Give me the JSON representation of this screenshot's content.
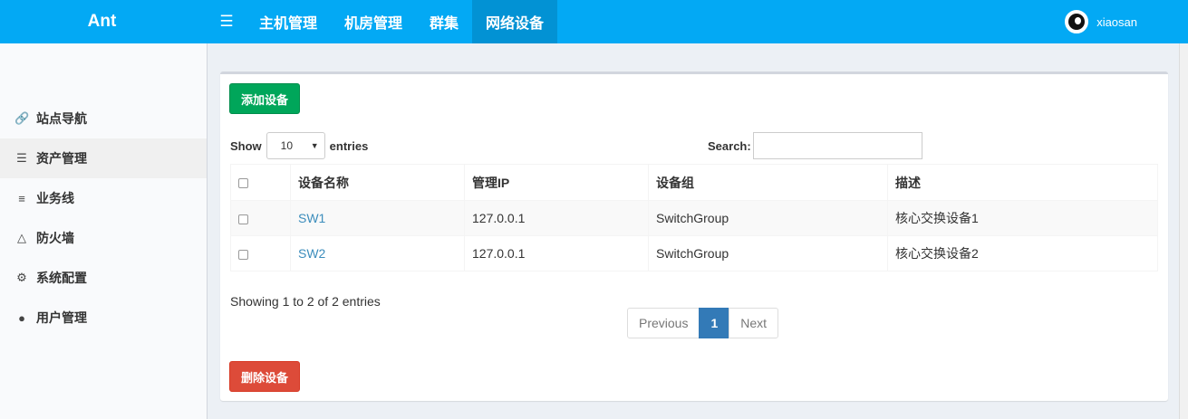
{
  "brand": "Ant",
  "topnav": {
    "toggle_icon": "hamburger-icon",
    "items": [
      {
        "label": "主机管理"
      },
      {
        "label": "机房管理"
      },
      {
        "label": "群集"
      },
      {
        "label": "网络设备"
      }
    ],
    "active_index": 3,
    "user": "xiaosan"
  },
  "sidebar": {
    "items": [
      {
        "label": "站点导航",
        "icon": "link-icon"
      },
      {
        "label": "资产管理",
        "icon": "database-icon"
      },
      {
        "label": "业务线",
        "icon": "server-icon"
      },
      {
        "label": "防火墙",
        "icon": "firewall-icon"
      },
      {
        "label": "系统配置",
        "icon": "gear-icon"
      },
      {
        "label": "用户管理",
        "icon": "users-icon"
      }
    ],
    "active_index": 1
  },
  "main": {
    "add_button": "添加设备",
    "delete_button": "删除设备",
    "length": {
      "show": "Show",
      "value": "10",
      "entries": "entries"
    },
    "search_label": "Search:",
    "table": {
      "columns": [
        "设备名称",
        "管理IP",
        "设备组",
        "描述"
      ],
      "rows": [
        {
          "name": "SW1",
          "ip": "127.0.0.1",
          "group": "SwitchGroup",
          "desc": "核心交换设备1"
        },
        {
          "name": "SW2",
          "ip": "127.0.0.1",
          "group": "SwitchGroup",
          "desc": "核心交换设备2"
        }
      ]
    },
    "info": "Showing 1 to 2 of 2 entries",
    "pagination": {
      "previous": "Previous",
      "current": "1",
      "next": "Next"
    }
  },
  "colors": {
    "topbar": "#03a9f4",
    "add": "#00a65a",
    "delete": "#dd4b39",
    "page_active": "#337ab7",
    "link": "#3c8dbc"
  }
}
